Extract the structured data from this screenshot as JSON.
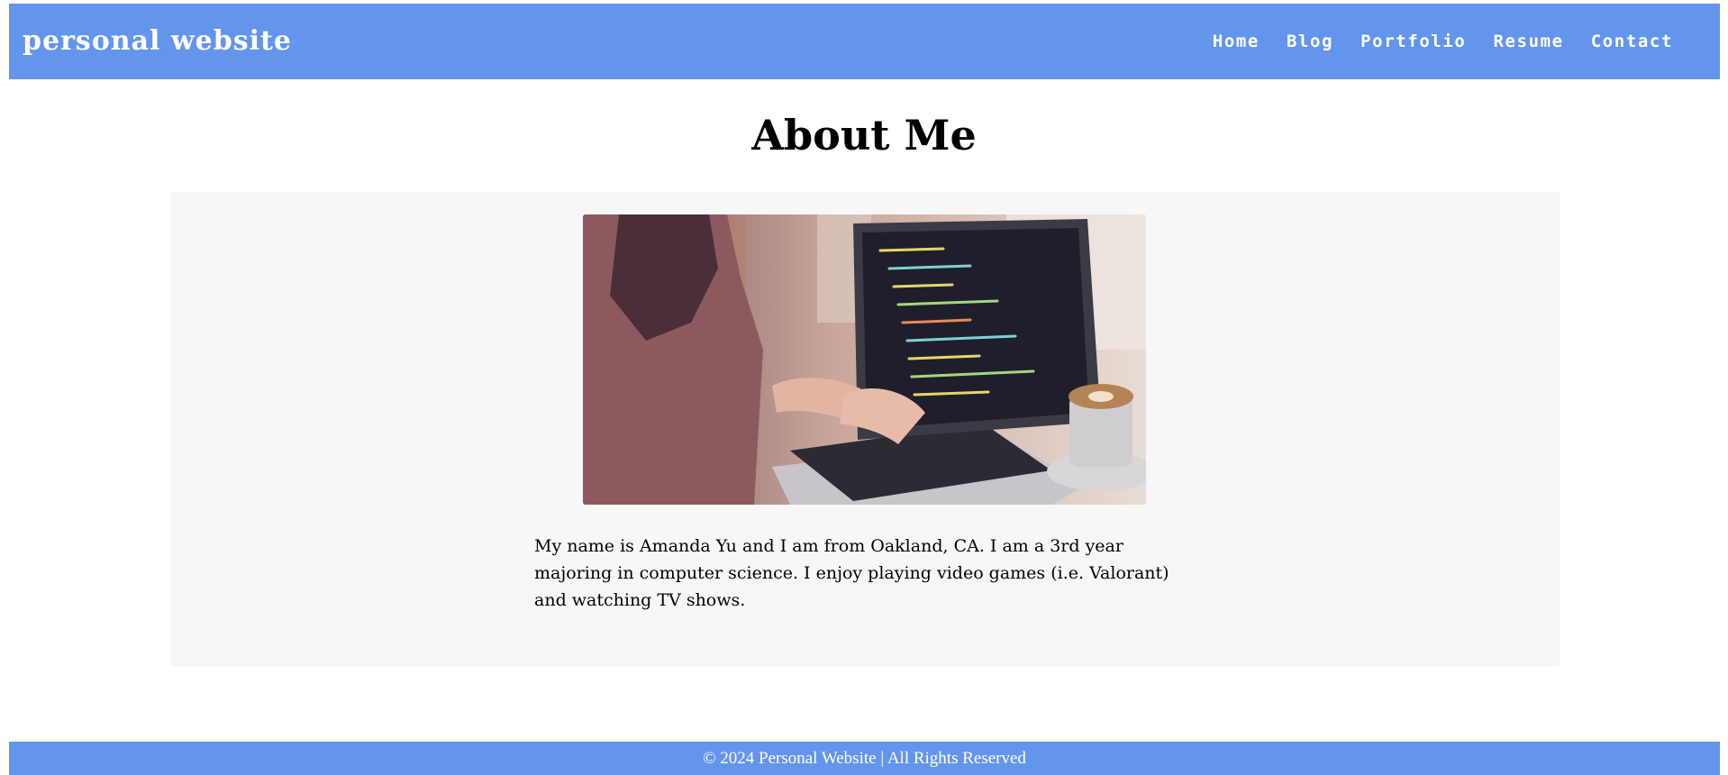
{
  "header": {
    "site_title": "personal website",
    "nav": [
      "Home",
      "Blog",
      "Portfolio",
      "Resume",
      "Contact"
    ]
  },
  "main": {
    "title": "About Me",
    "bio": "My name is Amanda Yu and I am from Oakland, CA. I am a 3rd year majoring in computer science. I enjoy playing video games (i.e. Valorant) and watching TV shows."
  },
  "footer": {
    "text": "© 2024 Personal Website | All Rights Reserved"
  },
  "colors": {
    "accent": "#6495ed",
    "card_background": "#f7f7f7",
    "page_background": "#ffffff"
  }
}
